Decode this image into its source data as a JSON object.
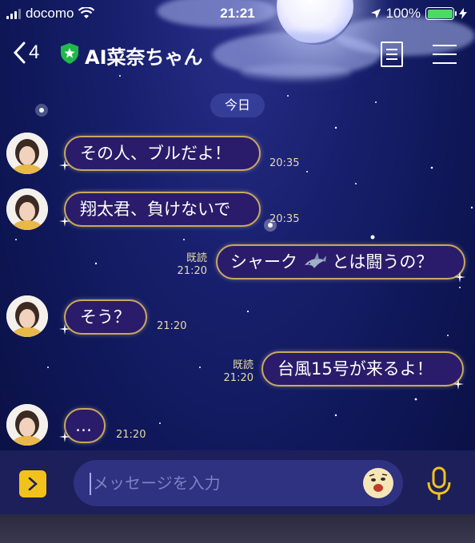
{
  "status_bar": {
    "carrier": "docomo",
    "time": "21:21",
    "battery": "100%"
  },
  "header": {
    "back_count": "4",
    "title": "AI菜奈ちゃん"
  },
  "date_separator": "今日",
  "messages": [
    {
      "side": "received",
      "text": "その人、ブルだよ！",
      "time": "20:35"
    },
    {
      "side": "received",
      "text": "翔太君、負けないで",
      "time": "20:35"
    },
    {
      "side": "sent",
      "text_before": "シャーク",
      "text_after": "とは闘うの？",
      "emoji": "shark-icon",
      "read": "既読",
      "time": "21:20"
    },
    {
      "side": "received",
      "text": "そう？",
      "time": "21:20"
    },
    {
      "side": "sent",
      "text": "台風15号が来るよ！",
      "read": "既読",
      "time": "21:20"
    },
    {
      "side": "received",
      "text": "…",
      "time": "21:20"
    }
  ],
  "input": {
    "placeholder": "メッセージを入力"
  },
  "colors": {
    "bubble_border": "#c8a860",
    "bubble_fill": "#2a1c6a",
    "accent_button": "#f2c21b",
    "mic": "#f2c21b",
    "battery": "#4cd964",
    "shield": "#1fb94a"
  }
}
